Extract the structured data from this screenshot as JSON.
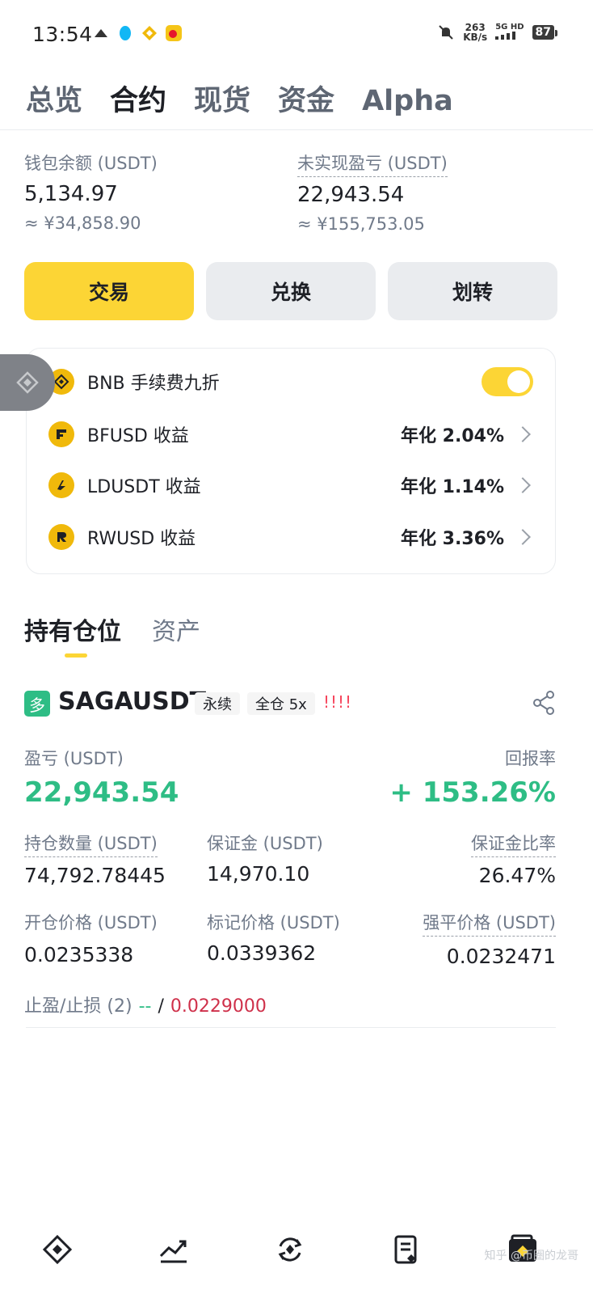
{
  "status": {
    "time": "13:54",
    "speed_value": "263",
    "speed_unit": "KB/s",
    "net": "5G HD",
    "battery": "87"
  },
  "top_tabs": [
    {
      "label": "总览",
      "active": false
    },
    {
      "label": "合约",
      "active": true
    },
    {
      "label": "现货",
      "active": false
    },
    {
      "label": "资金",
      "active": false
    },
    {
      "label": "Alpha",
      "active": false
    }
  ],
  "balance": {
    "wallet_label": "钱包余额 (USDT)",
    "wallet_value": "5,134.97",
    "wallet_cny": "≈ ¥34,858.90",
    "unrealized_label": "未实现盈亏 (USDT)",
    "unrealized_value": "22,943.54",
    "unrealized_cny": "≈ ¥155,753.05"
  },
  "actions": {
    "trade": "交易",
    "convert": "兑换",
    "transfer": "划转"
  },
  "promo": {
    "bnb_label": "BNB 手续费九折",
    "bnb_toggle_on": true,
    "items": [
      {
        "coin": "BFUSD",
        "label": "BFUSD 收益",
        "rate": "年化 2.04%"
      },
      {
        "coin": "LDUSDT",
        "label": "LDUSDT 收益",
        "rate": "年化 1.14%"
      },
      {
        "coin": "RWUSD",
        "label": "RWUSD 收益",
        "rate": "年化 3.36%"
      }
    ]
  },
  "position_tabs": {
    "holdings": "持有仓位",
    "assets": "资产"
  },
  "position": {
    "side_badge": "多",
    "symbol": "SAGAUSDT",
    "tag_perpetual": "永续",
    "tag_margin": "全仓 5x",
    "warning": "!!!!",
    "pnl_label": "盈亏 (USDT)",
    "pnl_value": "22,943.54",
    "roi_label": "回报率",
    "roi_value": "+ 153.26%",
    "size_label": "持仓数量 (USDT)",
    "size_value": "74,792.78445",
    "margin_label": "保证金 (USDT)",
    "margin_value": "14,970.10",
    "margin_ratio_label": "保证金比率",
    "margin_ratio_value": "26.47%",
    "entry_label": "开仓价格 (USDT)",
    "entry_value": "0.0235338",
    "mark_label": "标记价格 (USDT)",
    "mark_value": "0.0339362",
    "liq_label": "强平价格 (USDT)",
    "liq_value": "0.0232471",
    "tpsl_label": "止盈/止损 (2)",
    "tp_value": "--",
    "tpsl_sep": "/",
    "sl_value": "0.0229000"
  },
  "watermark": "知乎 @币圈的龙哥",
  "colors": {
    "accent": "#fcd535",
    "positive": "#2ebd85",
    "negative": "#cf304a"
  }
}
